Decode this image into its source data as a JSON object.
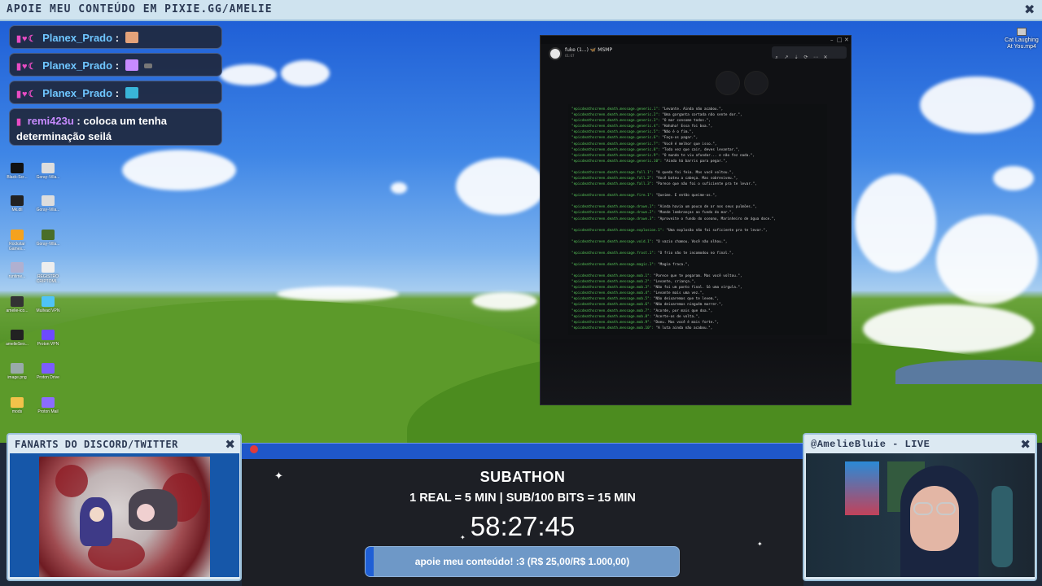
{
  "banner": {
    "title": "APOIE MEU CONTEÚDO EM PIXIE.GG/AMELIE"
  },
  "chat": [
    {
      "badges": "▮♥☾",
      "user": "Planex_Prado",
      "sep": ":",
      "emote_color": "#e3a27a",
      "text": ""
    },
    {
      "badges": "▮♥☾",
      "user": "Planex_Prado",
      "sep": ":",
      "emote_color": "#c78bff",
      "text": ""
    },
    {
      "badges": "▮♥☾",
      "user": "Planex_Prado",
      "sep": ":",
      "emote_color": "#39b5d8",
      "text": ""
    },
    {
      "badges": "▮",
      "user": "remi423u",
      "sep": ":",
      "text": "coloca um tenha",
      "text2": "determinação seilá"
    }
  ],
  "desktop_icons": [
    {
      "label": "Black-Scr...",
      "color": "#111"
    },
    {
      "label": "Goray-Villa...",
      "color": "#ddd"
    },
    {
      "label": "Mk.dll",
      "color": "#222"
    },
    {
      "label": "Goray-Villa...",
      "color": "#ddd"
    },
    {
      "label": "Rockstar Games...",
      "color": "#f4a21e"
    },
    {
      "label": "Goray-Villa...",
      "color": "#4a6e2a"
    },
    {
      "label": "runtime...",
      "color": "#b0b0d0"
    },
    {
      "label": "REGISTRO CRIPTOMI...",
      "color": "#eee"
    },
    {
      "label": "amelie-ico...",
      "color": "#333"
    },
    {
      "label": "Mullvad VPN",
      "color": "#4fc3f7"
    },
    {
      "label": "amelieSeo...",
      "color": "#222"
    },
    {
      "label": "Proton VPN",
      "color": "#6d4aff"
    },
    {
      "label": "image.png",
      "color": "#9aa"
    },
    {
      "label": "Proton Drive",
      "color": "#7b5cff"
    },
    {
      "label": "mods",
      "color": "#f2c24a"
    },
    {
      "label": "Proton Mail",
      "color": "#8b6cff"
    }
  ],
  "corner_icon": {
    "label": "Cat Laughing At You.mp4"
  },
  "discord": {
    "name": "fuke (1...) 🦋 MSMP",
    "time": "01:07",
    "toolbar": [
      "⌕",
      "↗",
      "⇣",
      "⟳",
      "⋯",
      "✕"
    ],
    "code": [
      {
        "k": "\"epicdeathscreen.death.message.generic.1\":",
        "v": " \"Levante. Ainda não acabou.\","
      },
      {
        "k": "\"epicdeathscreen.death.message.generic.2\":",
        "v": " \"Uma garganta cortada não sente dor.\","
      },
      {
        "k": "\"epicdeathscreen.death.message.generic.3\":",
        "v": " \"O mar consome todos.\","
      },
      {
        "k": "\"epicdeathscreen.death.message.generic.4\":",
        "v": " \"Hahaha! Essa foi boa.\","
      },
      {
        "k": "\"epicdeathscreen.death.message.generic.5\":",
        "v": " \"Não é o fim.\","
      },
      {
        "k": "\"epicdeathscreen.death.message.generic.6\":",
        "v": " \"Faça-os pagar.\","
      },
      {
        "k": "\"epicdeathscreen.death.message.generic.7\":",
        "v": " \"Você é melhor que isso.\","
      },
      {
        "k": "\"epicdeathscreen.death.message.generic.8\":",
        "v": " \"Toda vez que cair, deves levantar.\","
      },
      {
        "k": "\"epicdeathscreen.death.message.generic.9\":",
        "v": " \"O mundo te viu afundar... e não fez nada.\","
      },
      {
        "k": "\"epicdeathscreen.death.message.generic.10\":",
        "v": " \"Ainda há barris para pegar.\","
      },
      {
        "gap": true
      },
      {
        "k": "\"epicdeathscreen.death.message.fall.1\":",
        "v": " \"A queda foi feia. Mas você voltou.\","
      },
      {
        "k": "\"epicdeathscreen.death.message.fall.2\":",
        "v": " \"Você bateu a cabeça. Mas sobreviveu.\","
      },
      {
        "k": "\"epicdeathscreen.death.message.fall.3\":",
        "v": " \"Parece que não foi o suficiente pra te levar.\","
      },
      {
        "gap": true
      },
      {
        "k": "\"epicdeathscreen.death.message.fire.1\":",
        "v": " \"Queime. E então queime-os.\","
      },
      {
        "gap": true
      },
      {
        "k": "\"epicdeathscreen.death.message.drown.1\":",
        "v": " \"Ainda havia um pouco de ar nos seus pulmões.\","
      },
      {
        "k": "\"epicdeathscreen.death.message.drown.2\":",
        "v": " \"Mande lembranças ao fundo do mar.\","
      },
      {
        "k": "\"epicdeathscreen.death.message.drown.3\":",
        "v": " \"Aproveite o fundo do oceano, Marinheiro de água doce.\","
      },
      {
        "gap": true
      },
      {
        "k": "\"epicdeathscreen.death.message.explosion.1\":",
        "v": " \"Uma explosão não foi suficiente pra te levar.\","
      },
      {
        "gap": true
      },
      {
        "k": "\"epicdeathscreen.death.message.void.1\":",
        "v": " \"O vazio chamou. Você não olhou.\","
      },
      {
        "gap": true
      },
      {
        "k": "\"epicdeathscreen.death.message.frost.1\":",
        "v": " \"O frio não te incomodou no final.\","
      },
      {
        "gap": true
      },
      {
        "k": "\"epicdeathscreen.death.message.magic.1\":",
        "v": " \"Magia fraca.\","
      },
      {
        "gap": true
      },
      {
        "k": "\"epicdeathscreen.death.message.mob.1\":",
        "v": " \"Parece que te pegaram. Mas você voltou.\","
      },
      {
        "k": "\"epicdeathscreen.death.message.mob.2\":",
        "v": " \"Levante, criança.\","
      },
      {
        "k": "\"epicdeathscreen.death.message.mob.3\":",
        "v": " \"Não foi um ponto final. Só uma vírgula.\","
      },
      {
        "k": "\"epicdeathscreen.death.message.mob.4\":",
        "v": " \"Levante mais uma vez.\","
      },
      {
        "k": "\"epicdeathscreen.death.message.mob.5\":",
        "v": " \"Não deixaremos que te levem.\","
      },
      {
        "k": "\"epicdeathscreen.death.message.mob.6\":",
        "v": " \"Não deixaremos ninguém morrer.\","
      },
      {
        "k": "\"epicdeathscreen.death.message.mob.7\":",
        "v": " \"Acorde, por mais que doa.\","
      },
      {
        "k": "\"epicdeathscreen.death.message.mob.8\":",
        "v": " \"Acerte-os de volta.\","
      },
      {
        "k": "\"epicdeathscreen.death.message.mob.9\":",
        "v": " \"Doeu. Mas você é mais forte.\","
      },
      {
        "k": "\"epicdeathscreen.death.message.mob.10\":",
        "v": " \"A luta ainda não acabou.\","
      }
    ]
  },
  "fanart_panel": {
    "title": "FANARTS DO DISCORD/TWITTER"
  },
  "cam_panel": {
    "title": "@AmelieBluie  -  LIVE"
  },
  "subathon": {
    "title": "SUBATHON",
    "rules": "1 REAL = 5 MIN | SUB/100 BITS = 15 MIN",
    "timer": "58:27:45",
    "goal_text": "apoie meu conteúdo! :3 (R$ 25,00/R$ 1.000,00)",
    "goal_progress": 0.025
  },
  "colors": {
    "accent": "#1f5fd6",
    "panel": "#dce9f2",
    "chat_bg": "#1f283e"
  }
}
